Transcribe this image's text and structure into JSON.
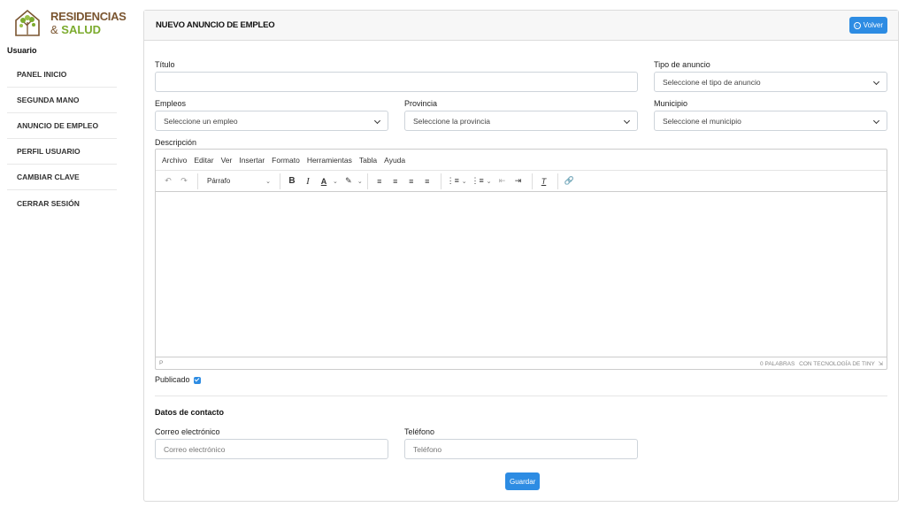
{
  "brand": {
    "line1": "RESIDENCIAS",
    "line2_prefix": "& ",
    "line2_highlight": "SALUD"
  },
  "sidebar": {
    "user_label": "Usuario",
    "items": [
      {
        "label": "PANEL INICIO"
      },
      {
        "label": "SEGUNDA MANO"
      },
      {
        "label": "ANUNCIO DE EMPLEO"
      },
      {
        "label": "PERFIL USUARIO"
      },
      {
        "label": "CAMBIAR CLAVE"
      },
      {
        "label": "CERRAR SESIÓN"
      }
    ]
  },
  "header": {
    "title": "NUEVO ANUNCIO DE EMPLEO",
    "back_label": "Volver"
  },
  "form": {
    "titulo_label": "Título",
    "titulo_value": "",
    "tipo_label": "Tipo de anuncio",
    "tipo_value": "Seleccione el tipo de anuncio",
    "empleos_label": "Empleos",
    "empleos_value": "Seleccione un empleo",
    "provincia_label": "Provincia",
    "provincia_value": "Seleccione la provincia",
    "municipio_label": "Municipio",
    "municipio_value": "Seleccione el municipio",
    "descripcion_label": "Descripción",
    "publicado_label": "Publicado",
    "publicado_checked": true
  },
  "editor": {
    "menu": [
      "Archivo",
      "Editar",
      "Ver",
      "Insertar",
      "Formato",
      "Herramientas",
      "Tabla",
      "Ayuda"
    ],
    "block_format": "Párrafo",
    "status_path": "P",
    "status_words": "0 PALABRAS",
    "status_powered": "CON TECNOLOGÍA DE TINY"
  },
  "contact": {
    "title": "Datos de contacto",
    "email_label": "Correo electrónico",
    "email_placeholder": "Correo electrónico",
    "phone_label": "Teléfono",
    "phone_placeholder": "Teléfono"
  },
  "actions": {
    "save_label": "Guardar"
  },
  "colors": {
    "primary": "#2d8ce3",
    "brand_brown": "#7a5530",
    "brand_green": "#7cab2e"
  }
}
